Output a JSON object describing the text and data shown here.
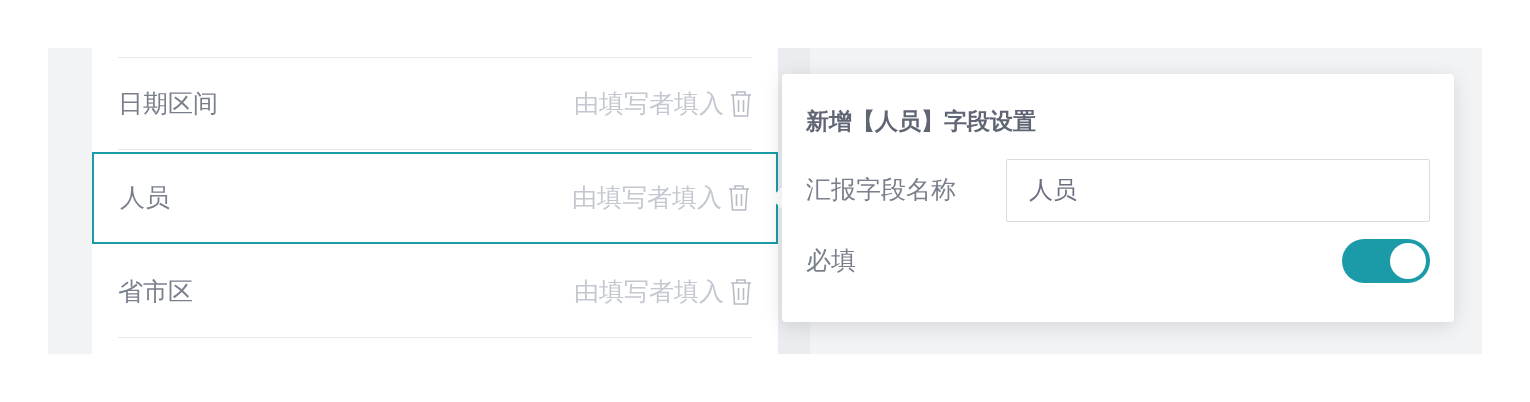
{
  "fields": [
    {
      "name": "日期区间",
      "hint": "由填写者填入",
      "selected": false
    },
    {
      "name": "人员",
      "hint": "由填写者填入",
      "selected": true
    },
    {
      "name": "省市区",
      "hint": "由填写者填入",
      "selected": false
    }
  ],
  "settings": {
    "title": "新增【人员】字段设置",
    "name_label": "汇报字段名称",
    "name_value": "人员",
    "required_label": "必填",
    "required_on": true
  }
}
